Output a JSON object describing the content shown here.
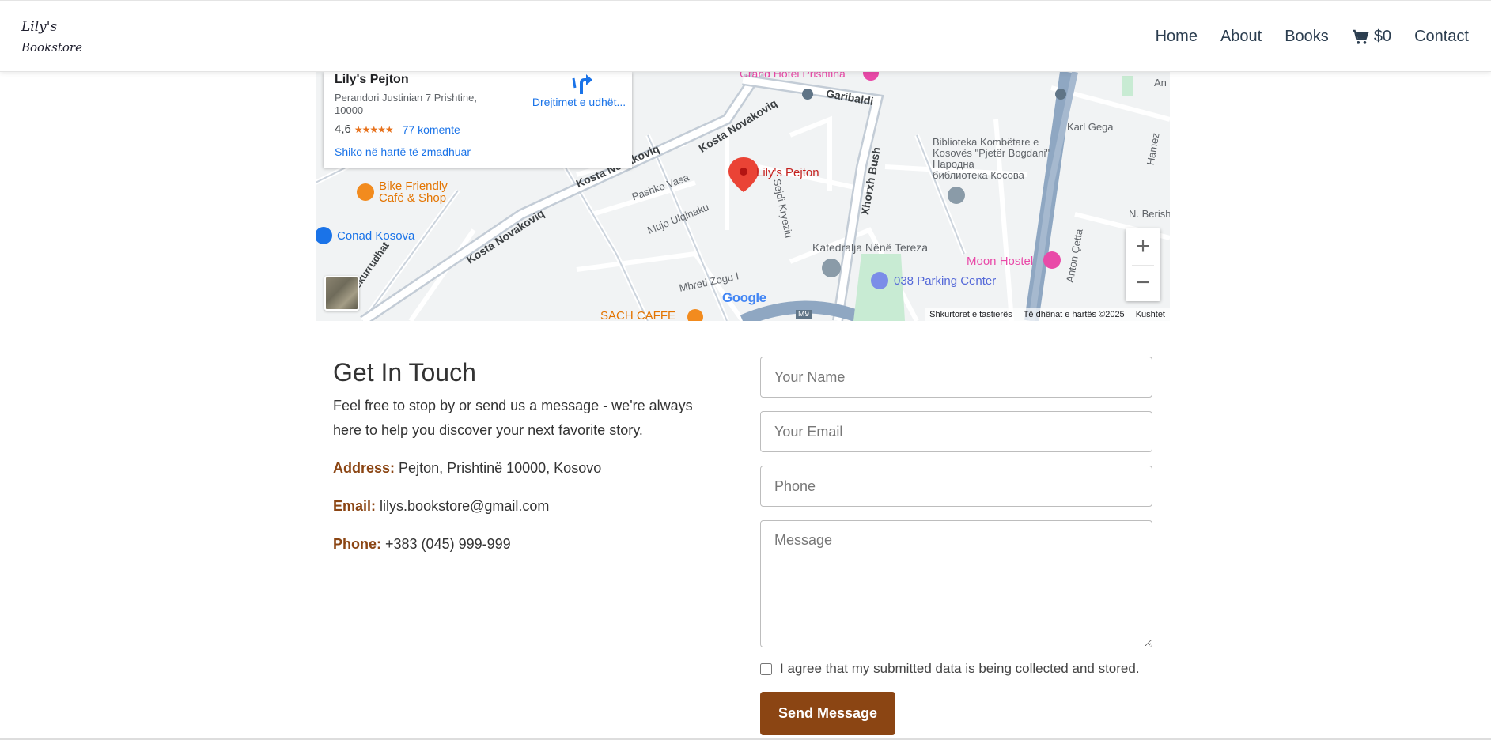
{
  "brand": {
    "line1": "Lily's",
    "line2": "Bookstore"
  },
  "nav": {
    "home": "Home",
    "about": "About",
    "books": "Books",
    "cart_total": "$0",
    "contact": "Contact"
  },
  "map": {
    "place_name": "Lily's Pejton",
    "place_address": "Perandori Justinian 7 Prishtine, 10000",
    "rating": "4,6",
    "stars": "★★★★★",
    "reviews": "77 komente",
    "view_larger": "Shiko në hartë të zmadhuar",
    "directions": "Drejtimet e udhët...",
    "pin_label": "Lily's Pejton",
    "labels": {
      "grand_hotel": "Grand Hotel Prishtina",
      "garibaldi": "Garibaldi",
      "kosta1": "Kosta Novakoviq",
      "kosta2": "Kosta Novakoviq",
      "kosta3": "Kosta Novakoviq",
      "pashko": "Pashko Vasa",
      "mujo": "Mujo Ulqinaku",
      "sejdi": "Sejdi Kryeziu",
      "xhorxh": "Xhorxh Bush",
      "library1": "Biblioteka Kombëtare e",
      "library2": "Kosovës \"Pjetër Bogdani\"",
      "library3": "Народна",
      "library4": "библиотека Косова",
      "karl": "Karl Gega",
      "cathedral": "Katedralja Nënë Tereza",
      "moon_hostel": "Moon Hostel",
      "parking": "038 Parking Center",
      "bike1": "Bike Friendly",
      "bike2": "Café & Shop",
      "conad": "Conad Kosova",
      "dekurrudhat": "dekurrudhat",
      "mbreti": "Mbreti Zogu I",
      "sach": "SACH CAFFE",
      "anton": "Anton Çetta",
      "nberisha": "N. Berish",
      "hamez": "Hamez",
      "m9": "M9",
      "an": "An"
    },
    "google": "Google",
    "shortcuts": "Shkurtoret e tastierës",
    "map_data": "Të dhënat e hartës ©2025",
    "terms": "Kushtet"
  },
  "contact": {
    "title": "Get In Touch",
    "intro": "Feel free to stop by or send us a message - we're always here to help you discover your next favorite story.",
    "address_label": "Address:",
    "address": "Pejton, Prishtinë 10000, Kosovo",
    "email_label": "Email:",
    "email": "lilys.bookstore@gmail.com",
    "phone_label": "Phone:",
    "phone": "+383 (045) 999-999"
  },
  "form": {
    "name_placeholder": "Your Name",
    "email_placeholder": "Your Email",
    "phone_placeholder": "Phone",
    "message_placeholder": "Message",
    "agree": "I agree that my submitted data is being collected and stored.",
    "send": "Send Message"
  }
}
